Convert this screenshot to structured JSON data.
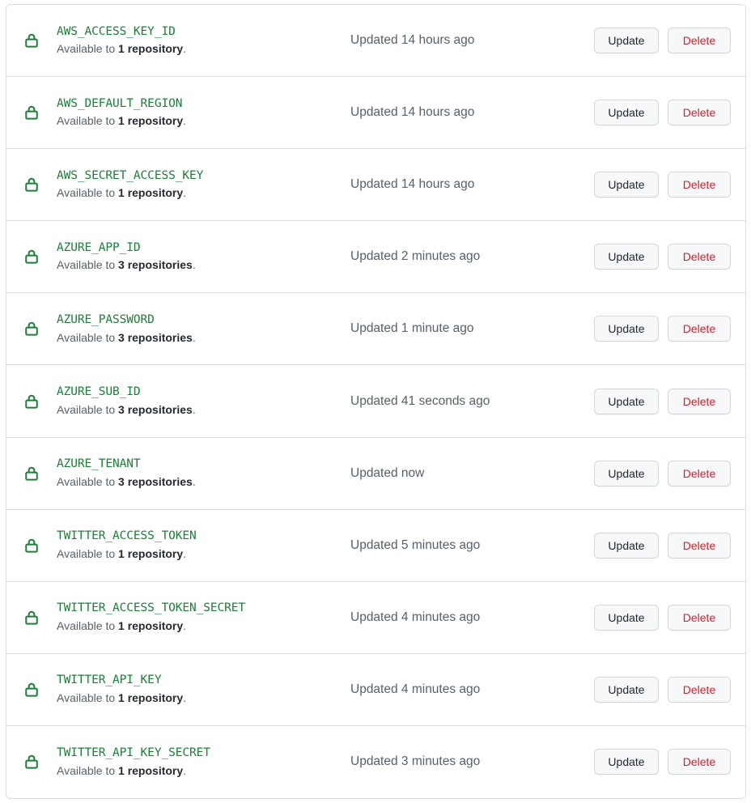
{
  "panel": {
    "name": "repository-secrets-list",
    "lock_icon": "lock-icon"
  },
  "buttons": {
    "update_label": "Update",
    "delete_label": "Delete"
  },
  "colors": {
    "secret_name": "#1a7f37",
    "lock_icon": "#1a7f37",
    "delete_text": "#cf222e",
    "update_text": "#24292f",
    "muted_text": "#57606a",
    "border": "#d8dee4",
    "button_bg": "#f6f8fa",
    "panel_bg": "#ffffff"
  },
  "secrets": [
    {
      "name": "AWS_ACCESS_KEY_ID",
      "availability_prefix": "Available to ",
      "availability_count": "1 repository",
      "availability_suffix": ".",
      "updated": "Updated 14 hours ago"
    },
    {
      "name": "AWS_DEFAULT_REGION",
      "availability_prefix": "Available to ",
      "availability_count": "1 repository",
      "availability_suffix": ".",
      "updated": "Updated 14 hours ago"
    },
    {
      "name": "AWS_SECRET_ACCESS_KEY",
      "availability_prefix": "Available to ",
      "availability_count": "1 repository",
      "availability_suffix": ".",
      "updated": "Updated 14 hours ago"
    },
    {
      "name": "AZURE_APP_ID",
      "availability_prefix": "Available to ",
      "availability_count": "3 repositories",
      "availability_suffix": ".",
      "updated": "Updated 2 minutes ago"
    },
    {
      "name": "AZURE_PASSWORD",
      "availability_prefix": "Available to ",
      "availability_count": "3 repositories",
      "availability_suffix": ".",
      "updated": "Updated 1 minute ago"
    },
    {
      "name": "AZURE_SUB_ID",
      "availability_prefix": "Available to ",
      "availability_count": "3 repositories",
      "availability_suffix": ".",
      "updated": "Updated 41 seconds ago"
    },
    {
      "name": "AZURE_TENANT",
      "availability_prefix": "Available to ",
      "availability_count": "3 repositories",
      "availability_suffix": ".",
      "updated": "Updated now"
    },
    {
      "name": "TWITTER_ACCESS_TOKEN",
      "availability_prefix": "Available to ",
      "availability_count": "1 repository",
      "availability_suffix": ".",
      "updated": "Updated 5 minutes ago"
    },
    {
      "name": "TWITTER_ACCESS_TOKEN_SECRET",
      "availability_prefix": "Available to ",
      "availability_count": "1 repository",
      "availability_suffix": ".",
      "updated": "Updated 4 minutes ago"
    },
    {
      "name": "TWITTER_API_KEY",
      "availability_prefix": "Available to ",
      "availability_count": "1 repository",
      "availability_suffix": ".",
      "updated": "Updated 4 minutes ago"
    },
    {
      "name": "TWITTER_API_KEY_SECRET",
      "availability_prefix": "Available to ",
      "availability_count": "1 repository",
      "availability_suffix": ".",
      "updated": "Updated 3 minutes ago"
    }
  ]
}
